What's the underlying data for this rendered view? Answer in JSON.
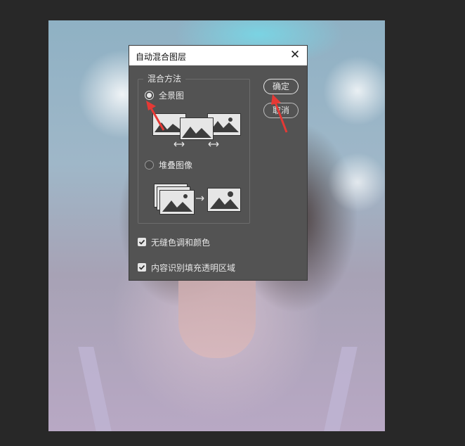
{
  "dialog": {
    "title": "自动混合图层",
    "close_glyph": "✕",
    "group_label": "混合方法",
    "options": [
      {
        "label": "全景图",
        "selected": true
      },
      {
        "label": "堆叠图像",
        "selected": false
      }
    ],
    "buttons": {
      "ok": "确定",
      "cancel": "取消"
    },
    "checkboxes": [
      {
        "label": "无缝色调和颜色",
        "checked": true
      },
      {
        "label": "内容识别填充透明区域",
        "checked": true
      }
    ]
  },
  "annotations": {
    "arrow_color": "#e53935"
  },
  "colors": {
    "dialog_bg": "#535353",
    "app_bg": "#282828",
    "titlebar": "#ffffff"
  }
}
